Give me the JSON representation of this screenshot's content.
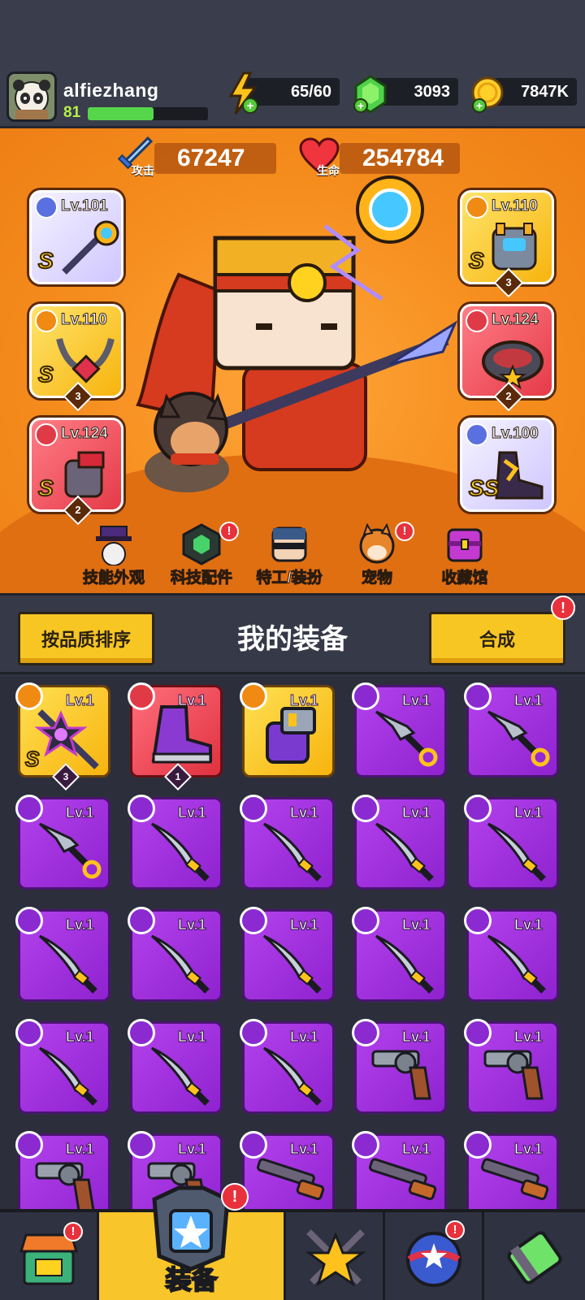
{
  "player": {
    "name": "alfiezhang",
    "level": "81",
    "xp_fraction": 0.55
  },
  "resources": {
    "energy": "65/60",
    "gems": "3093",
    "coins": "7847K"
  },
  "stats": {
    "attack_value": "67247",
    "attack_label": "攻击",
    "health_value": "254784",
    "health_label": "生命"
  },
  "equipped": [
    {
      "slot": "weapon",
      "level": "Lv.101",
      "rarity": "S",
      "stars": ""
    },
    {
      "slot": "necklace",
      "level": "Lv.110",
      "rarity": "S",
      "stars": "3"
    },
    {
      "slot": "gloves",
      "level": "Lv.124",
      "rarity": "S",
      "stars": "2"
    },
    {
      "slot": "armor",
      "level": "Lv.110",
      "rarity": "S",
      "stars": "3"
    },
    {
      "slot": "belt",
      "level": "Lv.124",
      "rarity": "",
      "stars": "2"
    },
    {
      "slot": "boots",
      "level": "Lv.100",
      "rarity": "SS",
      "stars": ""
    }
  ],
  "menu": [
    {
      "label": "技能外观",
      "alert": false
    },
    {
      "label": "科技配件",
      "alert": true
    },
    {
      "label": "特工/装扮",
      "alert": false
    },
    {
      "label": "宠物",
      "alert": true
    },
    {
      "label": "收藏馆",
      "alert": false
    }
  ],
  "equipment_section": {
    "sort_button": "按品质排序",
    "title": "我的装备",
    "merge_button": "合成",
    "merge_alert": "!"
  },
  "inventory": [
    {
      "item": "star-weapon",
      "level": "Lv.1",
      "tier": "gold",
      "rarity": "S",
      "stars": "3"
    },
    {
      "item": "boots",
      "level": "Lv.1",
      "tier": "red",
      "rarity": "",
      "stars": "1"
    },
    {
      "item": "gauntlet",
      "level": "Lv.1",
      "tier": "gold",
      "rarity": "",
      "stars": ""
    },
    {
      "item": "kunai",
      "level": "Lv.1",
      "tier": "purple",
      "rarity": "",
      "stars": ""
    },
    {
      "item": "kunai",
      "level": "Lv.1",
      "tier": "purple",
      "rarity": "",
      "stars": ""
    },
    {
      "item": "kunai",
      "level": "Lv.1",
      "tier": "purple",
      "rarity": "",
      "stars": ""
    },
    {
      "item": "katana",
      "level": "Lv.1",
      "tier": "purple",
      "rarity": "",
      "stars": ""
    },
    {
      "item": "katana",
      "level": "Lv.1",
      "tier": "purple",
      "rarity": "",
      "stars": ""
    },
    {
      "item": "katana",
      "level": "Lv.1",
      "tier": "purple",
      "rarity": "",
      "stars": ""
    },
    {
      "item": "katana",
      "level": "Lv.1",
      "tier": "purple",
      "rarity": "",
      "stars": ""
    },
    {
      "item": "katana",
      "level": "Lv.1",
      "tier": "purple",
      "rarity": "",
      "stars": ""
    },
    {
      "item": "katana",
      "level": "Lv.1",
      "tier": "purple",
      "rarity": "",
      "stars": ""
    },
    {
      "item": "katana",
      "level": "Lv.1",
      "tier": "purple",
      "rarity": "",
      "stars": ""
    },
    {
      "item": "katana",
      "level": "Lv.1",
      "tier": "purple",
      "rarity": "",
      "stars": ""
    },
    {
      "item": "katana",
      "level": "Lv.1",
      "tier": "purple",
      "rarity": "",
      "stars": ""
    },
    {
      "item": "katana",
      "level": "Lv.1",
      "tier": "purple",
      "rarity": "",
      "stars": ""
    },
    {
      "item": "katana",
      "level": "Lv.1",
      "tier": "purple",
      "rarity": "",
      "stars": ""
    },
    {
      "item": "katana",
      "level": "Lv.1",
      "tier": "purple",
      "rarity": "",
      "stars": ""
    },
    {
      "item": "revolver",
      "level": "Lv.1",
      "tier": "purple",
      "rarity": "",
      "stars": ""
    },
    {
      "item": "revolver",
      "level": "Lv.1",
      "tier": "purple",
      "rarity": "",
      "stars": ""
    },
    {
      "item": "revolver",
      "level": "Lv.1",
      "tier": "purple",
      "rarity": "",
      "stars": ""
    },
    {
      "item": "revolver",
      "level": "Lv.1",
      "tier": "purple",
      "rarity": "",
      "stars": ""
    },
    {
      "item": "shotgun",
      "level": "Lv.1",
      "tier": "purple",
      "rarity": "",
      "stars": ""
    },
    {
      "item": "shotgun",
      "level": "Lv.1",
      "tier": "purple",
      "rarity": "",
      "stars": ""
    },
    {
      "item": "shotgun",
      "level": "Lv.1",
      "tier": "purple",
      "rarity": "",
      "stars": ""
    }
  ],
  "bottom_nav": {
    "active_label": "装备",
    "alert": "!"
  }
}
